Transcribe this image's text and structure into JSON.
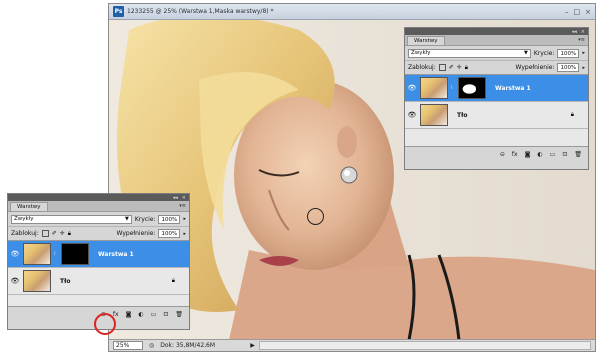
{
  "document": {
    "title": "1233255 @ 25% (Warstwa 1,Maska warstwy/8) *",
    "logo": "Ps",
    "controls": [
      "–",
      "□",
      "×"
    ],
    "status": {
      "zoom": "25%",
      "doc_info": "Dok: 35,8M/42,6M",
      "arrow": "▶"
    }
  },
  "layers_panel_large": {
    "tab": "Warstwy",
    "blend_mode": "Zwykły",
    "opacity_label": "Krycie:",
    "opacity_value": "100%",
    "lock_label": "Zablokuj:",
    "fill_label": "Wypełnienie:",
    "fill_value": "100%",
    "layers": [
      {
        "name": "Warstwa 1",
        "selected": true,
        "mask": "white"
      },
      {
        "name": "Tło",
        "selected": false,
        "locked": true
      }
    ]
  },
  "layers_panel_small": {
    "tab": "Warstwy",
    "blend_mode": "Zwykły",
    "opacity_label": "Krycie:",
    "opacity_value": "100%",
    "lock_label": "Zablokuj:",
    "fill_label": "Wypełnienie:",
    "fill_value": "100%",
    "layers": [
      {
        "name": "Warstwa 1",
        "selected": true,
        "mask": "black"
      },
      {
        "name": "Tło",
        "selected": false,
        "locked": true
      }
    ]
  },
  "panel_buttons": [
    "link-layers",
    "fx",
    "add-mask",
    "adjustment",
    "folder",
    "new-layer",
    "trash"
  ],
  "colors": {
    "selection": "#3d8ee6",
    "highlight_ring": "#d22222",
    "panel_bg": "#d6d6d6"
  }
}
